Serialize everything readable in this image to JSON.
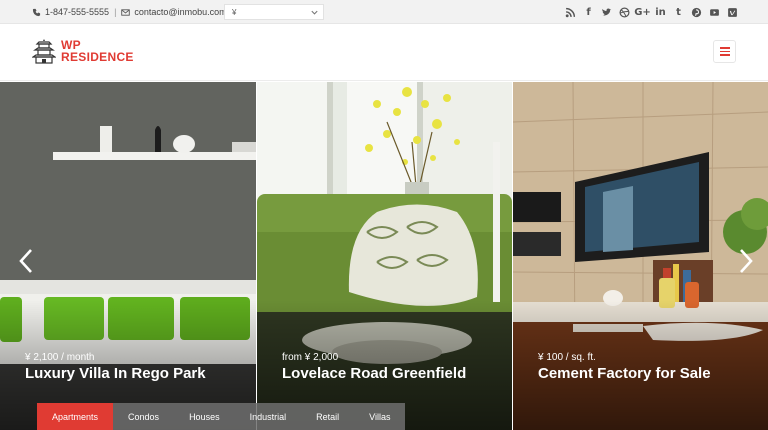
{
  "topbar": {
    "phone": "1-847-555-5555",
    "separator": "|",
    "email": "contacto@inmobu.com",
    "currency": "¥",
    "socials": [
      "rss-icon",
      "facebook-icon",
      "twitter-icon",
      "dribbble-icon",
      "google-plus-icon",
      "linkedin-icon",
      "tumblr-icon",
      "pinterest-icon",
      "youtube-icon",
      "vimeo-icon"
    ],
    "social_glyphs": {
      "facebook": "f",
      "twitter": "t",
      "google": "G+",
      "linkedin": "in",
      "tumblr": "t",
      "pinterest": "P"
    }
  },
  "header": {
    "logo_line1": "WP",
    "logo_line2": "RESIDENCE"
  },
  "slides": [
    {
      "price": "¥ 2,100 / month",
      "title": "Luxury Villa In Rego Park"
    },
    {
      "price": "from ¥ 2,000",
      "title": "Lovelace Road Greenfield"
    },
    {
      "price": "¥ 100 / sq. ft.",
      "title": "Cement Factory for Sale"
    }
  ],
  "tabs": [
    {
      "label": "Apartments",
      "active": true
    },
    {
      "label": "Condos",
      "active": false
    },
    {
      "label": "Houses",
      "active": false
    },
    {
      "label": "Industrial",
      "active": false
    },
    {
      "label": "Retail",
      "active": false
    },
    {
      "label": "Villas",
      "active": false
    }
  ],
  "colors": {
    "accent": "#e03b33",
    "topbar_bg": "#f2f2f2",
    "tab_bg": "#6e6e6e"
  }
}
